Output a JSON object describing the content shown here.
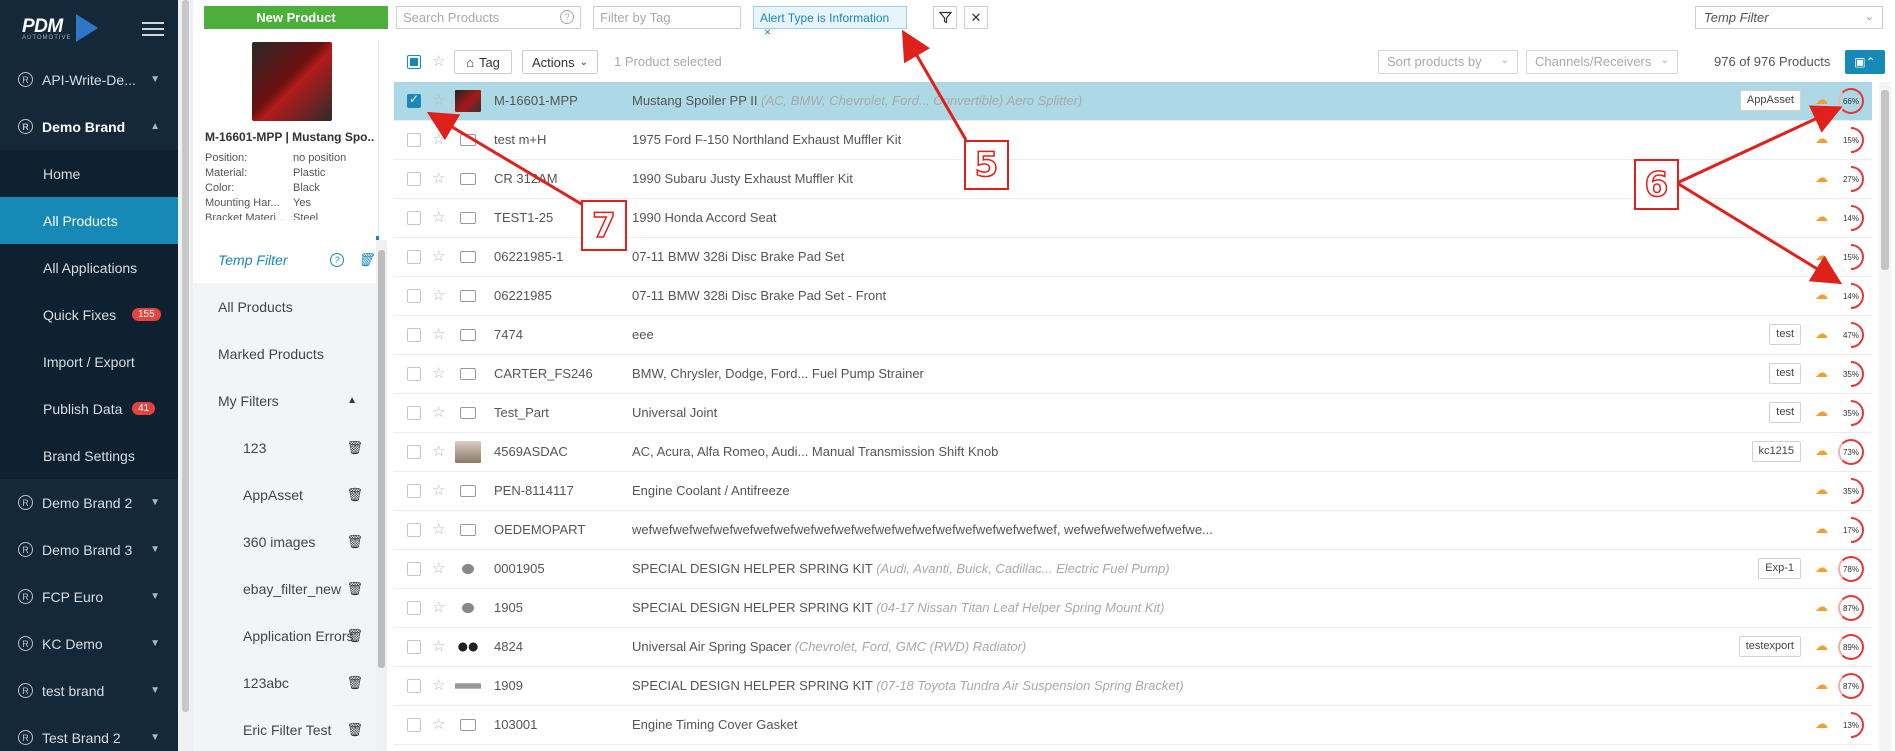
{
  "sidebar": {
    "logo": "PDM",
    "logo_sub": "AUTOMOTIVE",
    "items": [
      {
        "label": "API-Write-De...",
        "type": "brand",
        "expanded": false
      },
      {
        "label": "Demo Brand",
        "type": "brand",
        "expanded": true
      },
      {
        "label": "Home",
        "type": "sub"
      },
      {
        "label": "All Products",
        "type": "sub",
        "selected": true
      },
      {
        "label": "All Applications",
        "type": "sub"
      },
      {
        "label": "Quick Fixes",
        "type": "sub",
        "badge": "155"
      },
      {
        "label": "Import / Export",
        "type": "sub"
      },
      {
        "label": "Publish Data",
        "type": "sub",
        "badge": "41"
      },
      {
        "label": "Brand Settings",
        "type": "sub"
      },
      {
        "label": "Demo Brand 2",
        "type": "brand"
      },
      {
        "label": "Demo Brand 3",
        "type": "brand"
      },
      {
        "label": "FCP Euro",
        "type": "brand"
      },
      {
        "label": "KC Demo",
        "type": "brand"
      },
      {
        "label": "test brand",
        "type": "brand"
      },
      {
        "label": "Test Brand 2",
        "type": "brand"
      }
    ]
  },
  "topbar": {
    "new_product": "New Product",
    "search_placeholder": "Search Products",
    "tag_placeholder": "Filter by Tag",
    "chip": "Alert Type is Information",
    "temp_filter": "Temp Filter"
  },
  "panel": {
    "title": "M-16601-MPP | Mustang Spo...",
    "attributes": [
      {
        "k": "Position:",
        "v": "no position"
      },
      {
        "k": "Material:",
        "v": "Plastic"
      },
      {
        "k": "Color:",
        "v": "Black"
      },
      {
        "k": "Mounting Har...",
        "v": "Yes"
      },
      {
        "k": "Bracket Materi...",
        "v": "Steel"
      }
    ],
    "nav": {
      "temp_filter": "Temp Filter",
      "all_products": "All Products",
      "marked_products": "Marked Products",
      "my_filters": "My Filters",
      "filters": [
        "123",
        "AppAsset",
        "360 images",
        "ebay_filter_new",
        "Application Errors",
        "123abc",
        "Eric Filter Test"
      ]
    }
  },
  "toolbar": {
    "tag": "Tag",
    "actions": "Actions",
    "selected": "1 Product selected",
    "sort": "Sort products by",
    "channels": "Channels/Receivers",
    "count": "976 of 976 Products"
  },
  "rows": [
    {
      "sku": "M-16601-MPP",
      "name": "Mustang Spoiler PP II",
      "extra": "(AC, BMW, Chevrolet, Ford... Convertible) Aero Splitter)",
      "tag": "AppAsset",
      "pct": "66%",
      "selected": true,
      "img": "red"
    },
    {
      "sku": "test m+H",
      "name": "1975 Ford F-150 Northland Exhaust Muffler Kit",
      "extra": "",
      "tag": "",
      "pct": "15%"
    },
    {
      "sku": "CR 312AM",
      "name": "1990 Subaru Justy Exhaust Muffler Kit",
      "extra": "",
      "tag": "",
      "pct": "27%"
    },
    {
      "sku": "TEST1-25",
      "name": "1990 Honda Accord Seat",
      "extra": "",
      "tag": "",
      "pct": "14%"
    },
    {
      "sku": "06221985-1",
      "name": "07-11 BMW 328i Disc Brake Pad Set",
      "extra": "",
      "tag": "",
      "pct": "15%"
    },
    {
      "sku": "06221985",
      "name": "07-11 BMW 328i Disc Brake Pad Set - Front",
      "extra": "",
      "tag": "",
      "pct": "14%"
    },
    {
      "sku": "7474",
      "name": "eee",
      "extra": "",
      "tag": "test",
      "pct": "47%"
    },
    {
      "sku": "CARTER_FS246",
      "name": "BMW, Chrysler, Dodge, Ford... Fuel Pump Strainer",
      "extra": "",
      "tag": "test",
      "pct": "35%"
    },
    {
      "sku": "Test_Part",
      "name": "Universal Joint",
      "extra": "",
      "tag": "test",
      "pct": "35%"
    },
    {
      "sku": "4569ASDAC",
      "name": "AC, Acura, Alfa Romeo, Audi... Manual Transmission Shift Knob",
      "extra": "",
      "tag": "kc1215",
      "pct": "73%",
      "img": "knob"
    },
    {
      "sku": "PEN-8114117",
      "name": "Engine Coolant / Antifreeze",
      "extra": "",
      "tag": "",
      "pct": "35%"
    },
    {
      "sku": "OEDEMOPART",
      "name": "wefwefwefwefwefwefwefwefwefwefwefwefwefwefwefwefwefwefwefwefwef, wefwefwefwefwefwefwe...",
      "extra": "",
      "tag": "",
      "pct": "17%"
    },
    {
      "sku": "0001905",
      "name": "SPECIAL DESIGN HELPER SPRING KIT",
      "extra": "(Audi, Avanti, Buick, Cadillac... Electric Fuel Pump)",
      "tag": "Exp-1",
      "pct": "78%",
      "img": "spring"
    },
    {
      "sku": "1905",
      "name": "SPECIAL DESIGN HELPER SPRING KIT",
      "extra": "(04-17 Nissan Titan Leaf Helper Spring Mount Kit)",
      "tag": "",
      "pct": "87%",
      "img": "spring"
    },
    {
      "sku": "4824",
      "name": "Universal Air Spring Spacer",
      "extra": "(Chevrolet, Ford, GMC (RWD) Radiator)",
      "tag": "testexport",
      "pct": "89%",
      "img": "spacer"
    },
    {
      "sku": "1909",
      "name": "SPECIAL DESIGN HELPER SPRING KIT",
      "extra": "(07-18 Toyota Tundra Air Suspension Spring Bracket)",
      "tag": "",
      "pct": "87%",
      "img": "bar"
    },
    {
      "sku": "103001",
      "name": "Engine Timing Cover Gasket",
      "extra": "",
      "tag": "",
      "pct": "13%"
    }
  ],
  "annotations": [
    "5",
    "6",
    "7"
  ],
  "colors": {
    "accent": "#1789b6",
    "sidebar": "#15283a",
    "new_button": "#4caf3a",
    "annotation": "#e0201b",
    "selected_row": "#add8e6"
  }
}
